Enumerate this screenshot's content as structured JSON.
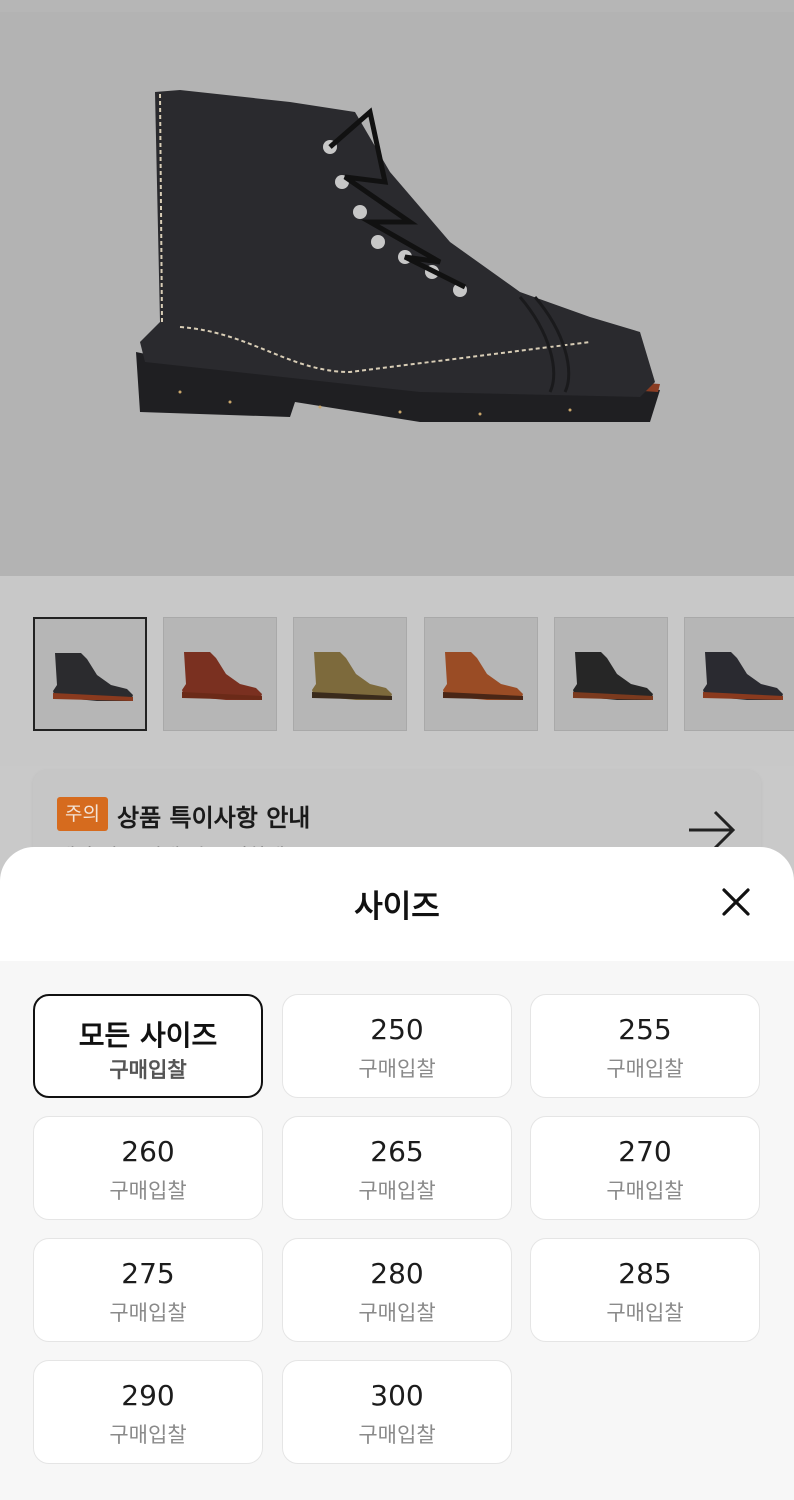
{
  "product": {
    "main_image": "black-leather-boot-image",
    "thumbnails": [
      {
        "name": "boot-black-thumb",
        "color": "#2b2b2e",
        "sole": "#8a3a1e"
      },
      {
        "name": "boot-red-brown-thumb",
        "color": "#7a3020",
        "sole": "#6b2a18"
      },
      {
        "name": "boot-olive-suede-thumb",
        "color": "#7d6a3c",
        "sole": "#3a2b1c"
      },
      {
        "name": "boot-copper-thumb",
        "color": "#9a4c25",
        "sole": "#4a2616"
      },
      {
        "name": "boot-black-2-thumb",
        "color": "#262626",
        "sole": "#7b3a1e"
      },
      {
        "name": "boot-black-3-thumb",
        "color": "#2a2a30",
        "sole": "#8a3a1e"
      }
    ]
  },
  "notice": {
    "badge": "주의",
    "title": "상품 특이사항 안내",
    "subtitle": "해당 상품 거래 시 주의하세요",
    "arrow_icon": "arrow-right-icon"
  },
  "sheet": {
    "title": "사이즈",
    "close_icon": "close-icon",
    "sizes": [
      {
        "value": "모든 사이즈",
        "sub": "구매입찰",
        "selected": true
      },
      {
        "value": "250",
        "sub": "구매입찰"
      },
      {
        "value": "255",
        "sub": "구매입찰"
      },
      {
        "value": "260",
        "sub": "구매입찰"
      },
      {
        "value": "265",
        "sub": "구매입찰"
      },
      {
        "value": "270",
        "sub": "구매입찰"
      },
      {
        "value": "275",
        "sub": "구매입찰"
      },
      {
        "value": "280",
        "sub": "구매입찰"
      },
      {
        "value": "285",
        "sub": "구매입찰"
      },
      {
        "value": "290",
        "sub": "구매입찰"
      },
      {
        "value": "300",
        "sub": "구매입찰"
      }
    ]
  },
  "colors": {
    "badge": "#d66b1e",
    "overlay_bg": "#c9c9c9",
    "selected_border": "#111111"
  }
}
